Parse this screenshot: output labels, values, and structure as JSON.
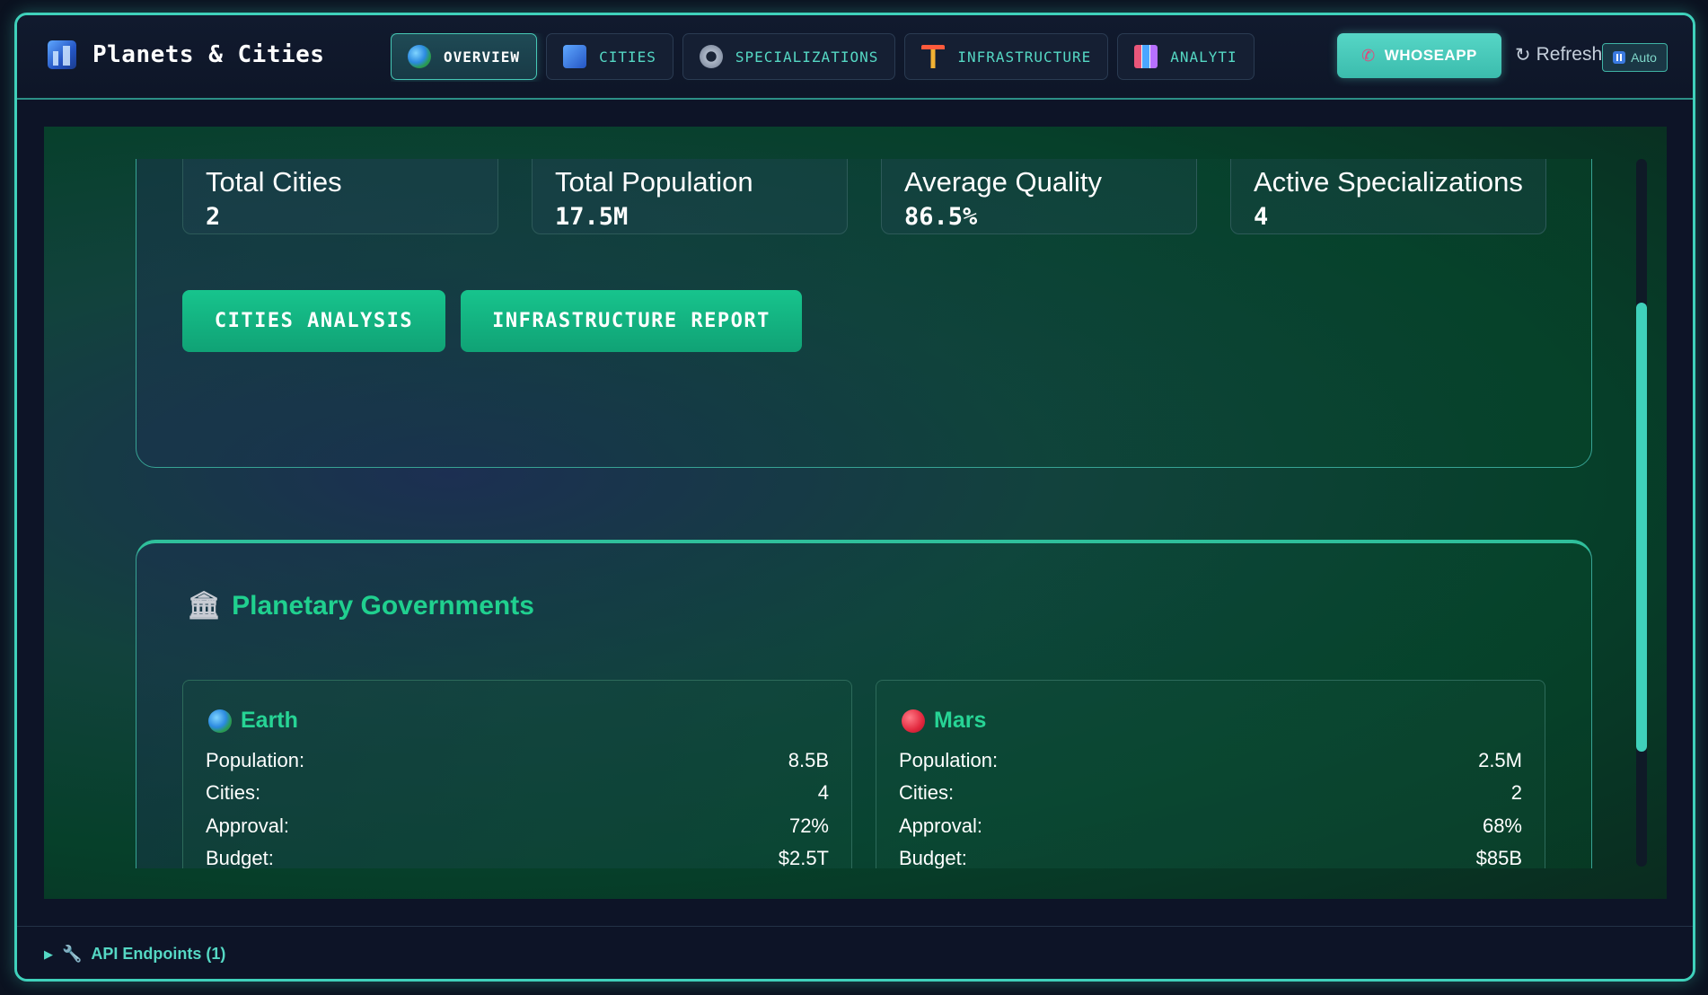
{
  "app": {
    "title": "Planets & Cities"
  },
  "tabs": [
    {
      "label": "OVERVIEW",
      "icon": "globe-icon",
      "active": true
    },
    {
      "label": "CITIES",
      "icon": "city-icon",
      "active": false
    },
    {
      "label": "SPECIALIZATIONS",
      "icon": "gear-icon",
      "active": false
    },
    {
      "label": "INFRASTRUCTURE",
      "icon": "crane-icon",
      "active": false
    },
    {
      "label": "ANALYTI",
      "icon": "bar-chart-icon",
      "active": false
    }
  ],
  "header_actions": {
    "whoseapp_label": "WHOSEAPP",
    "refresh_label": "Refresh",
    "refresh_symbol": "↻",
    "auto_label": "Auto"
  },
  "stats": [
    {
      "label": "Total Cities",
      "value": "2"
    },
    {
      "label": "Total Population",
      "value": "17.5M"
    },
    {
      "label": "Average Quality",
      "value": "86.5%"
    },
    {
      "label": "Active Specializations",
      "value": "4"
    }
  ],
  "actions": {
    "cities_analysis": "CITIES ANALYSIS",
    "infrastructure_report": "INFRASTRUCTURE REPORT"
  },
  "governments": {
    "title": "Planetary Governments",
    "planets": [
      {
        "name": "Earth",
        "rows": [
          {
            "label": "Population:",
            "value": "8.5B"
          },
          {
            "label": "Cities:",
            "value": "4"
          },
          {
            "label": "Approval:",
            "value": "72%"
          },
          {
            "label": "Budget:",
            "value": "$2.5T"
          }
        ]
      },
      {
        "name": "Mars",
        "rows": [
          {
            "label": "Population:",
            "value": "2.5M"
          },
          {
            "label": "Cities:",
            "value": "2"
          },
          {
            "label": "Approval:",
            "value": "68%"
          },
          {
            "label": "Budget:",
            "value": "$85B"
          }
        ]
      }
    ]
  },
  "footer": {
    "api_label": "API Endpoints (1)"
  },
  "colors": {
    "accent": "#3fd1bb",
    "button_green": "#17c48d",
    "heading_green": "#20d08f"
  }
}
